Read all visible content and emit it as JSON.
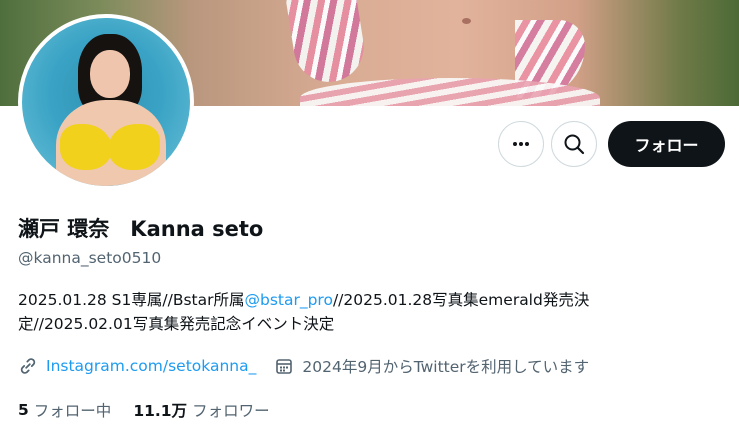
{
  "profile": {
    "display_name": "瀬戸 環奈　Kanna seto",
    "handle": "@kanna_seto0510",
    "bio_before": "2025.01.28 S1専属//Bstar所属",
    "bio_mention": "@bstar_pro",
    "bio_after": "//2025.01.28写真集emerald発売決定//2025.02.01写真集発売記念イベント決定",
    "link_text": "Instagram.com/setokanna_",
    "joined_text": "2024年9月からTwitterを利用しています"
  },
  "actions": {
    "more_icon": "more-dots-icon",
    "search_icon": "search-icon",
    "follow_label": "フォロー"
  },
  "stats": {
    "following_count": "5",
    "following_label": "フォロー中",
    "followers_count": "11.1万",
    "followers_label": "フォロワー"
  },
  "icons": {
    "link": "link-icon",
    "calendar": "calendar-icon"
  },
  "colors": {
    "accent": "#1d9bf0",
    "text_primary": "#0f1419",
    "text_secondary": "#536471",
    "follow_button": "#0f1419"
  }
}
